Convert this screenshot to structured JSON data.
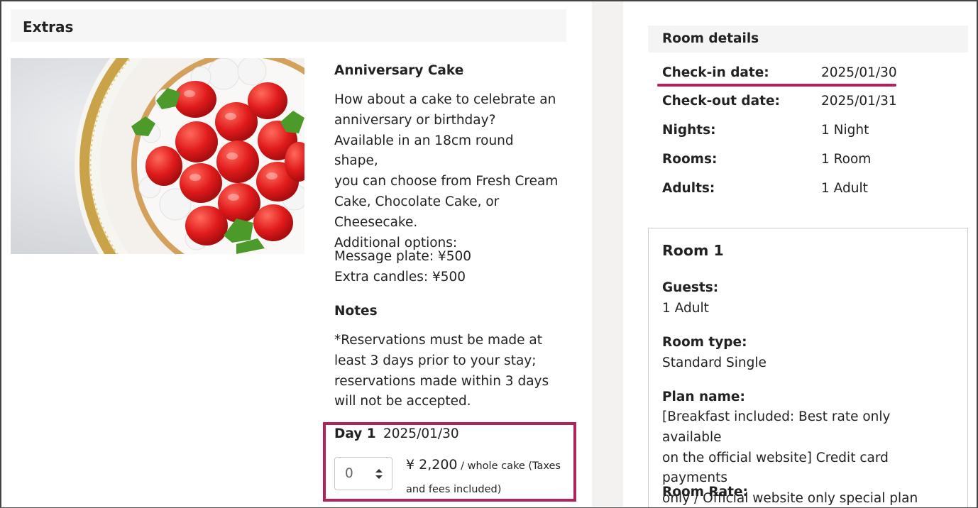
{
  "extras": {
    "header": "Extras",
    "item_title": "Anniversary Cake",
    "description": [
      "How about a cake to celebrate an",
      "anniversary or birthday?",
      "Available in an 18cm round shape,",
      "you can choose from Fresh Cream",
      "Cake, Chocolate Cake, or",
      "Cheesecake.",
      "Additional options:"
    ],
    "options": [
      "Message plate: ¥500",
      "Extra candles: ¥500"
    ],
    "notes_title": "Notes",
    "notes": [
      "*Reservations must be made at",
      "least 3 days prior to your stay;",
      "reservations made within 3 days",
      "will not be accepted."
    ],
    "day_label": "Day 1",
    "day_date": "2025/01/30",
    "quantity": "0",
    "price": "¥ 2,200",
    "price_unit_1": " / whole cake (Taxes",
    "price_unit_2": "and fees included)"
  },
  "room_details": {
    "header": "Room details",
    "rows": [
      {
        "label": "Check-in date:",
        "value": "2025/01/30"
      },
      {
        "label": "Check-out date:",
        "value": "2025/01/31"
      },
      {
        "label": "Nights:",
        "value": "1 Night"
      },
      {
        "label": "Rooms:",
        "value": "1 Room"
      },
      {
        "label": "Adults:",
        "value": "1 Adult"
      }
    ]
  },
  "room": {
    "title": "Room 1",
    "guests_label": "Guests:",
    "guests_value": "1 Adult",
    "type_label": "Room type:",
    "type_value": "Standard Single",
    "plan_label": "Plan name:",
    "plan_value": [
      "[Breakfast included: Best rate only available",
      "on the official website] Credit card payments",
      "only / Official website only special plan"
    ],
    "rate_label": "Room Rate:"
  },
  "colors": {
    "highlight": "#b0235a"
  }
}
